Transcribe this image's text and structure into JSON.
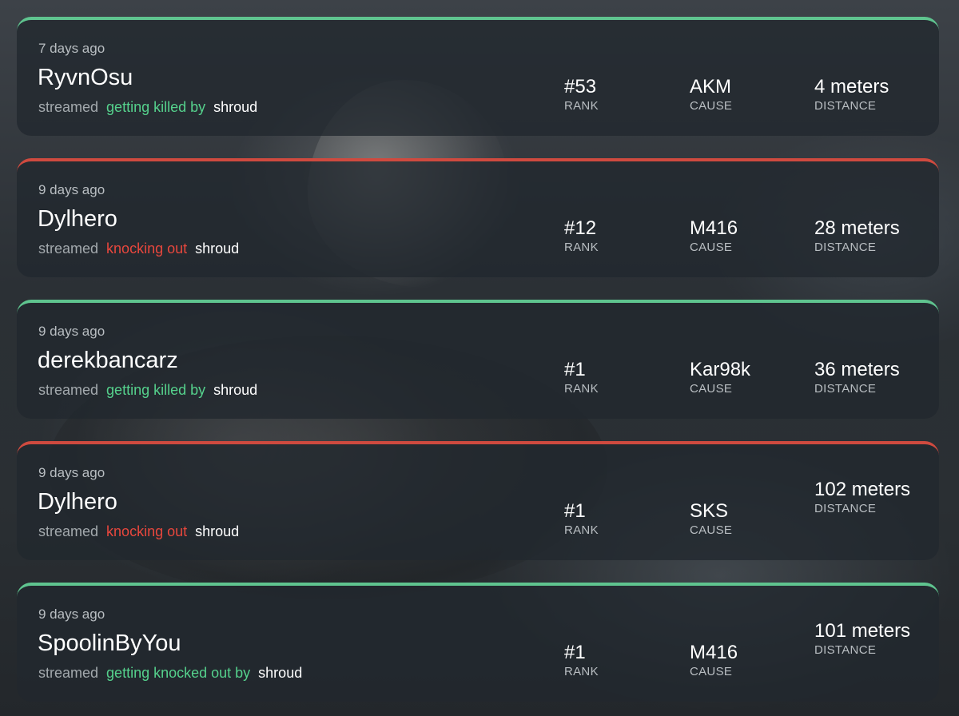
{
  "labels": {
    "streamed": "streamed",
    "rank": "RANK",
    "cause": "CAUSE",
    "distance": "DISTANCE"
  },
  "colors": {
    "positive_accent": "#5fc48f",
    "negative_accent": "#cf4a3f"
  },
  "events": [
    {
      "time": "7 days ago",
      "player": "RyvnOsu",
      "action": "getting killed by",
      "target": "shroud",
      "rank": "#53",
      "cause": "AKM",
      "distance": "4 meters",
      "tone": "green"
    },
    {
      "time": "9 days ago",
      "player": "Dylhero",
      "action": "knocking out",
      "target": "shroud",
      "rank": "#12",
      "cause": "M416",
      "distance": "28 meters",
      "tone": "red"
    },
    {
      "time": "9 days ago",
      "player": "derekbancarz",
      "action": "getting killed by",
      "target": "shroud",
      "rank": "#1",
      "cause": "Kar98k",
      "distance": "36 meters",
      "tone": "green"
    },
    {
      "time": "9 days ago",
      "player": "Dylhero",
      "action": "knocking out",
      "target": "shroud",
      "rank": "#1",
      "cause": "SKS",
      "distance": "102 meters",
      "tone": "red"
    },
    {
      "time": "9 days ago",
      "player": "SpoolinByYou",
      "action": "getting knocked out by",
      "target": "shroud",
      "rank": "#1",
      "cause": "M416",
      "distance": "101 meters",
      "tone": "green"
    }
  ]
}
